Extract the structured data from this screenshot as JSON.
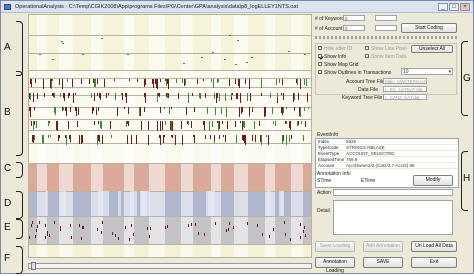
{
  "window": {
    "title": "OperationalAnalysis - C:\\Temp\\CGIK2008\\App\\programs Files\\PG\\Center\\GPA\\analysis\\data\\p8_logELLEY1NTS.oat"
  },
  "annotations": {
    "left": [
      "A",
      "B",
      "C",
      "D",
      "E",
      "F"
    ],
    "right": [
      "G",
      "H"
    ]
  },
  "top_fields": {
    "keyword_label": "# of Keyword ID",
    "keyword_value": "2",
    "account_label": "# of Account ID",
    "account_value": "0",
    "start_button": "Start Coding"
  },
  "options": {
    "hide_after": "Hide after ID",
    "show_info": "Show Info",
    "show_map_grid": "Show Map Grid",
    "show_outlines": "Show Outlines in Transactions",
    "show_lines": "Show Line Pixel",
    "show_items": "Show Item Data",
    "unselect_all": "Unselect All",
    "dropdown_value": "10"
  },
  "files": {
    "account_tree_label": "Account Tree File",
    "account_tree_value": "Main_MASTERS.txt",
    "data_label": "Data File",
    "data_value": "c_EC_LSTDAT.dat",
    "keyword_tree_label": "Keyword Tree File",
    "keyword_tree_value": "c_CAN3_KAT.dat"
  },
  "event_info": {
    "header": "EventInfo",
    "rows": [
      {
        "key": "Index",
        "value": "5928"
      },
      {
        "key": "TypeCode",
        "value": "STRINGS NBLAZE"
      },
      {
        "key": "EventType",
        "value": "ACCOUNT_SELECTED"
      },
      {
        "key": "ElapsedTime",
        "value": "769.9"
      },
      {
        "key": "Account",
        "value": "AcctOwner2/3 (Cat2/3.7-Acct2) 99"
      }
    ]
  },
  "annotation_info": {
    "header": "Annotation Info",
    "stime_label": "STime",
    "etime_label": "ETime",
    "modify_button": "Modify",
    "action_label": "Action",
    "detail_label": "Detail"
  },
  "buttons": {
    "save_loading": "Save Loading",
    "add_annotation": "Add Annotation",
    "unload_all": "Un Load All Data",
    "annotation_loading": "Annotation Loading",
    "save": "SAVE",
    "exit": "Exit"
  }
}
